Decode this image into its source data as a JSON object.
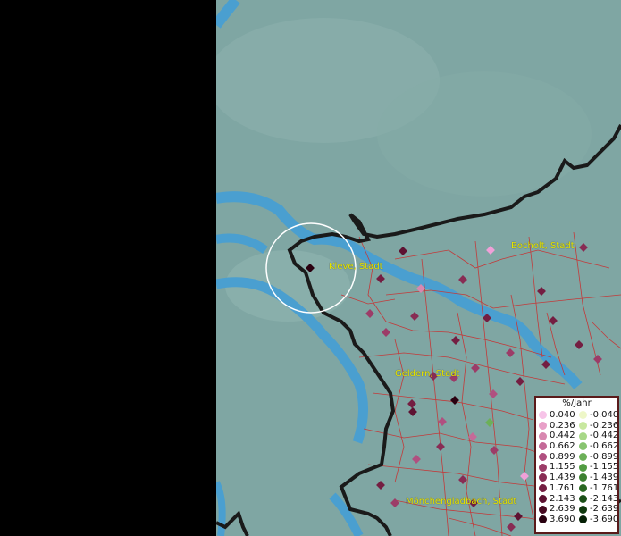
{
  "map": {
    "labels": {
      "bocholt": "Bocholt, Stadt",
      "kleve": "Kleve, Stadt",
      "geldern": "Geldern, Stadt",
      "moenchengladbach": "Mönchengladbach, Stadt"
    },
    "colors": {
      "background": "#7fa6a3",
      "river": "#4a9fd0",
      "border_national": "#1a1a1a",
      "border_district": "#c23a3a",
      "highlight_circle": "#ffffff",
      "label_text": "#e8e800"
    }
  },
  "legend": {
    "title": "%/Jahr",
    "positive": [
      {
        "value": "0.040",
        "color": "#f7c4e8"
      },
      {
        "value": "0.236",
        "color": "#e8a0c8"
      },
      {
        "value": "0.442",
        "color": "#d888b0"
      },
      {
        "value": "0.662",
        "color": "#c46a98"
      },
      {
        "value": "0.899",
        "color": "#b05080"
      },
      {
        "value": "1.155",
        "color": "#9c3c68"
      },
      {
        "value": "1.439",
        "color": "#882c54"
      },
      {
        "value": "1.761",
        "color": "#741e42"
      },
      {
        "value": "2.143",
        "color": "#5e1232"
      },
      {
        "value": "2.639",
        "color": "#480a22"
      },
      {
        "value": "3.690",
        "color": "#2a0010"
      }
    ],
    "negative": [
      {
        "value": "-0.040",
        "color": "#eef7c8"
      },
      {
        "value": "-0.236",
        "color": "#c8e8a0"
      },
      {
        "value": "-0.442",
        "color": "#a8d888"
      },
      {
        "value": "-0.662",
        "color": "#88c470"
      },
      {
        "value": "-0.899",
        "color": "#6cb058"
      },
      {
        "value": "-1.155",
        "color": "#529c42"
      },
      {
        "value": "-1.439",
        "color": "#3c8030"
      },
      {
        "value": "-1.761",
        "color": "#2a6822"
      },
      {
        "value": "-2.143",
        "color": "#1c5018"
      },
      {
        "value": "-2.639",
        "color": "#103a0e"
      },
      {
        "value": "-3.690",
        "color": "#052005"
      }
    ]
  },
  "stations": [
    {
      "name": "station",
      "color": "#5e1232"
    },
    {
      "name": "station",
      "color": "#f0a0d8"
    },
    {
      "name": "station",
      "color": "#882c54"
    },
    {
      "name": "station",
      "color": "#2a0010"
    },
    {
      "name": "station",
      "color": "#741e42"
    },
    {
      "name": "station",
      "color": "#882c54"
    },
    {
      "name": "station",
      "color": "#d888b0"
    },
    {
      "name": "station",
      "color": "#741e42"
    },
    {
      "name": "station",
      "color": "#9c3c68"
    },
    {
      "name": "station",
      "color": "#882c54"
    },
    {
      "name": "station",
      "color": "#741e42"
    },
    {
      "name": "station",
      "color": "#741e42"
    },
    {
      "name": "station",
      "color": "#9c3c68"
    },
    {
      "name": "station",
      "color": "#741e42"
    },
    {
      "name": "station",
      "color": "#741e42"
    },
    {
      "name": "station",
      "color": "#9c3c68"
    },
    {
      "name": "station",
      "color": "#9c3c68"
    },
    {
      "name": "station",
      "color": "#9c3c68"
    },
    {
      "name": "station",
      "color": "#741e42"
    },
    {
      "name": "station",
      "color": "#882c54"
    },
    {
      "name": "station",
      "color": "#9c3c68"
    },
    {
      "name": "station",
      "color": "#741e42"
    },
    {
      "name": "station",
      "color": "#b05080"
    },
    {
      "name": "station",
      "color": "#741e42"
    },
    {
      "name": "station",
      "color": "#2a0010"
    },
    {
      "name": "station",
      "color": "#b05080"
    },
    {
      "name": "station",
      "color": "#5e1232"
    },
    {
      "name": "station",
      "color": "#6cb058"
    },
    {
      "name": "station",
      "color": "#2a0010"
    },
    {
      "name": "station",
      "color": "#c46a98"
    },
    {
      "name": "station",
      "color": "#882c54"
    },
    {
      "name": "station",
      "color": "#9c3c68"
    },
    {
      "name": "station",
      "color": "#b05080"
    },
    {
      "name": "station",
      "color": "#882c54"
    },
    {
      "name": "station",
      "color": "#741e42"
    },
    {
      "name": "station",
      "color": "#9c3c68"
    },
    {
      "name": "station",
      "color": "#741e42"
    },
    {
      "name": "station",
      "color": "#882c54"
    },
    {
      "name": "station",
      "color": "#f0a0d8"
    },
    {
      "name": "station",
      "color": "#9c3c68"
    },
    {
      "name": "station",
      "color": "#741e42"
    },
    {
      "name": "station",
      "color": "#5e1232"
    },
    {
      "name": "station",
      "color": "#741e42"
    }
  ]
}
